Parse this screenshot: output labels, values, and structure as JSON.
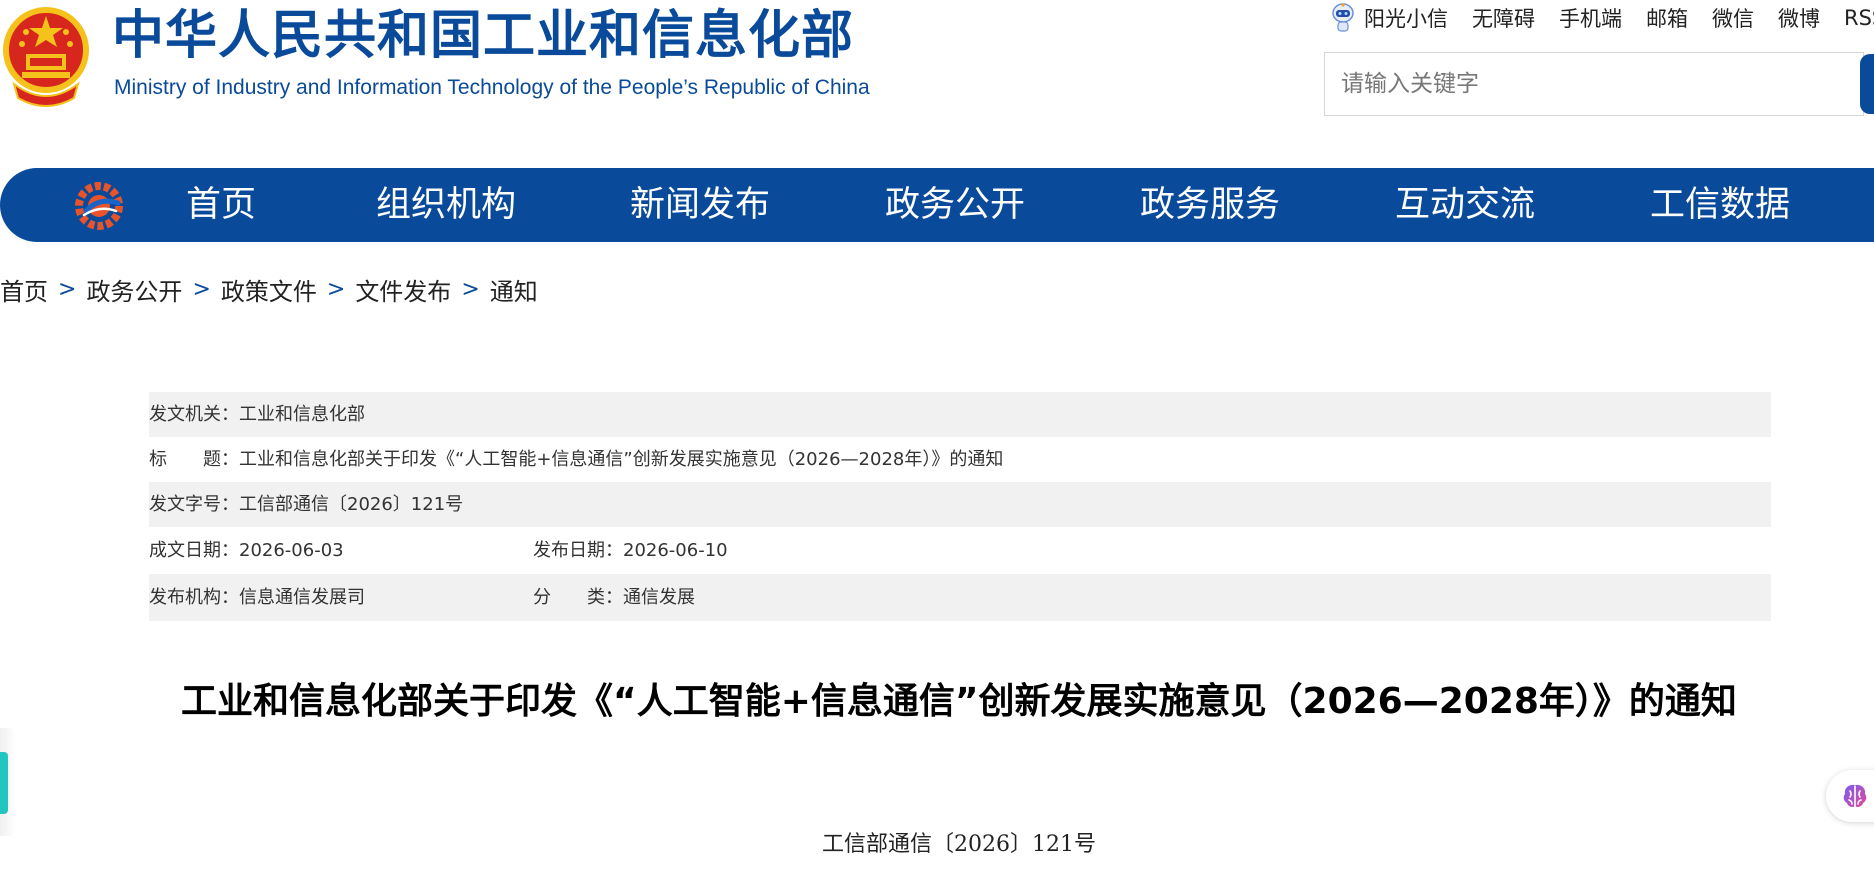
{
  "header": {
    "title": "中华人民共和国工业和信息化部",
    "subtitle": "Ministry of Industry and Information Technology of the People’s Republic of China",
    "top_links": [
      "阳光小信",
      "无障碍",
      "手机端",
      "邮箱",
      "微信",
      "微博",
      "RSS"
    ],
    "search_placeholder": "请输入关键字"
  },
  "nav": {
    "items": [
      "首页",
      "组织机构",
      "新闻发布",
      "政务公开",
      "政务服务",
      "互动交流",
      "工信数据"
    ]
  },
  "breadcrumb": [
    "首页",
    "政务公开",
    "政策文件",
    "文件发布",
    "通知"
  ],
  "info": {
    "issuer_label": "发文机关：",
    "issuer": "工业和信息化部",
    "title_label": "标　　题：",
    "title": "工业和信息化部关于印发《“人工智能+信息通信”创新发展实施意见（2026—2028年）》的通知",
    "doc_no_label": "发文字号：",
    "doc_no": "工信部通信〔2026〕121号",
    "written_date_label": "成文日期：",
    "written_date": "2026-06-03",
    "publish_date_label": "发布日期：",
    "publish_date": "2026-06-10",
    "publisher_label": "发布机构：",
    "publisher": "信息通信发展司",
    "category_label": "分　　类：",
    "category": "通信发展"
  },
  "document": {
    "title": "工业和信息化部关于印发《“人工智能+信息通信”创新发展实施意见（2026—2028年）》的通知",
    "number": "工信部通信〔2026〕121号"
  },
  "colors": {
    "brand_blue": "#0a4a9a",
    "row_gray": "#f1f1f1",
    "emblem_red": "#d7261e",
    "emblem_gold": "#f5c21b"
  }
}
